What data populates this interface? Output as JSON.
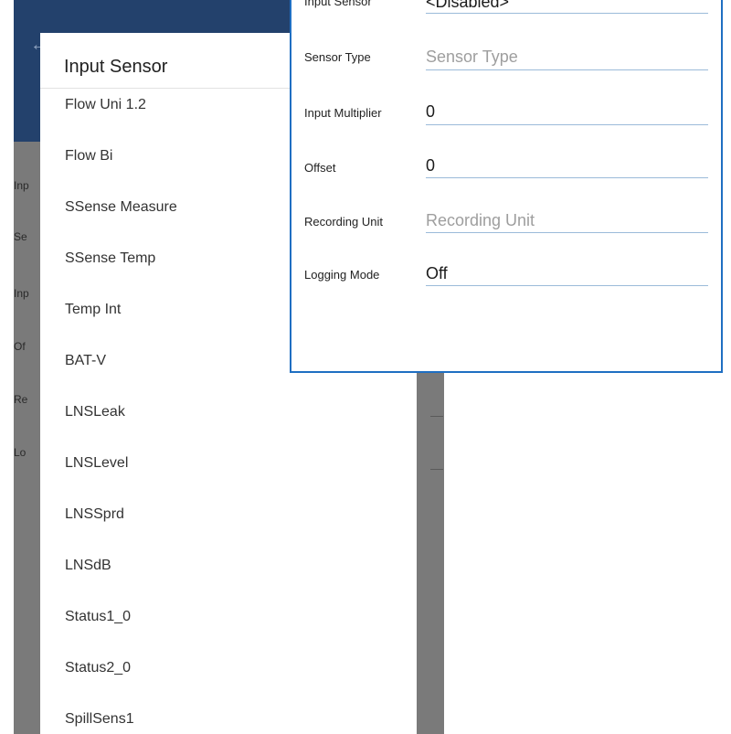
{
  "background": {
    "back_icon": "arrow-left-icon",
    "field_labels": [
      "Inp",
      "Se",
      "Inp",
      "Of",
      "Re",
      "Lo"
    ]
  },
  "dialog": {
    "title": "Input Sensor",
    "options": [
      "Flow Uni 1.2",
      "Flow Bi",
      "SSense Measure",
      "SSense Temp",
      "Temp Int",
      "BAT-V",
      "LNSLeak",
      "LNSLevel",
      "LNSSprd",
      "LNSdB",
      "Status1_0",
      "Status2_0",
      "SpillSens1"
    ]
  },
  "settings": {
    "fields": [
      {
        "label": "Input Sensor",
        "value": "<Disabled>",
        "is_placeholder": false
      },
      {
        "label": "Sensor Type",
        "value": "Sensor Type",
        "is_placeholder": true
      },
      {
        "label": "Input Multiplier",
        "value": "0",
        "is_placeholder": false
      },
      {
        "label": "Offset",
        "value": "0",
        "is_placeholder": false
      },
      {
        "label": "Recording Unit",
        "value": "Recording Unit",
        "is_placeholder": true
      },
      {
        "label": "Logging Mode",
        "value": "Off",
        "is_placeholder": false
      }
    ]
  },
  "colors": {
    "appbar": "#23416c",
    "panel_border": "#1f6fc2",
    "underline": "#9bbbd9",
    "scrim": "#7a7a7a"
  }
}
